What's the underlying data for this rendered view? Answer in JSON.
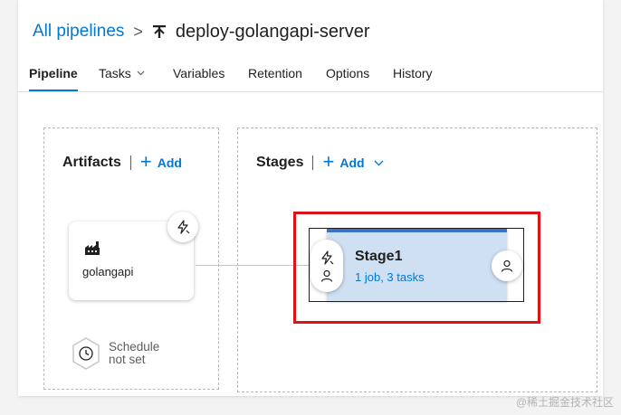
{
  "breadcrumb": {
    "root": "All pipelines",
    "separator": ">",
    "title": "deploy-golangapi-server"
  },
  "tabs": [
    {
      "label": "Pipeline",
      "active": true
    },
    {
      "label": "Tasks",
      "has_dropdown": true
    },
    {
      "label": "Variables"
    },
    {
      "label": "Retention"
    },
    {
      "label": "Options"
    },
    {
      "label": "History"
    }
  ],
  "artifacts": {
    "heading": "Artifacts",
    "add_label": "Add",
    "items": [
      {
        "name": "golangapi",
        "icon": "build-factory-icon"
      }
    ],
    "schedule_label": [
      "Schedule",
      "not set"
    ]
  },
  "stages": {
    "heading": "Stages",
    "add_label": "Add",
    "items": [
      {
        "name": "Stage1",
        "summary": "1 job, 3 tasks"
      }
    ]
  },
  "icons": {
    "chevron": "⌄",
    "lightning": "lightning-icon",
    "person": "person-icon",
    "clock": "clock-icon"
  },
  "colors": {
    "accent": "#0078d4",
    "stage_fill": "#cfe0f3",
    "stage_bar": "#3a72c8",
    "highlight": "#d9141b"
  },
  "watermark": "@稀土掘金技术社区"
}
